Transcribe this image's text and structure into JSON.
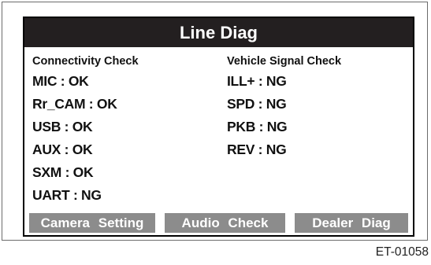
{
  "screen": {
    "title": "Line Diag"
  },
  "connectivity": {
    "header": "Connectivity Check",
    "rows": [
      "MIC : OK",
      "Rr_CAM : OK",
      "USB : OK",
      "AUX : OK",
      "SXM : OK",
      "UART : NG"
    ]
  },
  "vehicle_signal": {
    "header": "Vehicle Signal Check",
    "rows": [
      "ILL+ : NG",
      "SPD : NG",
      "PKB : NG",
      "REV : NG"
    ]
  },
  "buttons": {
    "camera_setting": "Camera Setting",
    "audio_check": "Audio Check",
    "dealer_diag": "Dealer Diag"
  },
  "figure_code": "ET-01058"
}
